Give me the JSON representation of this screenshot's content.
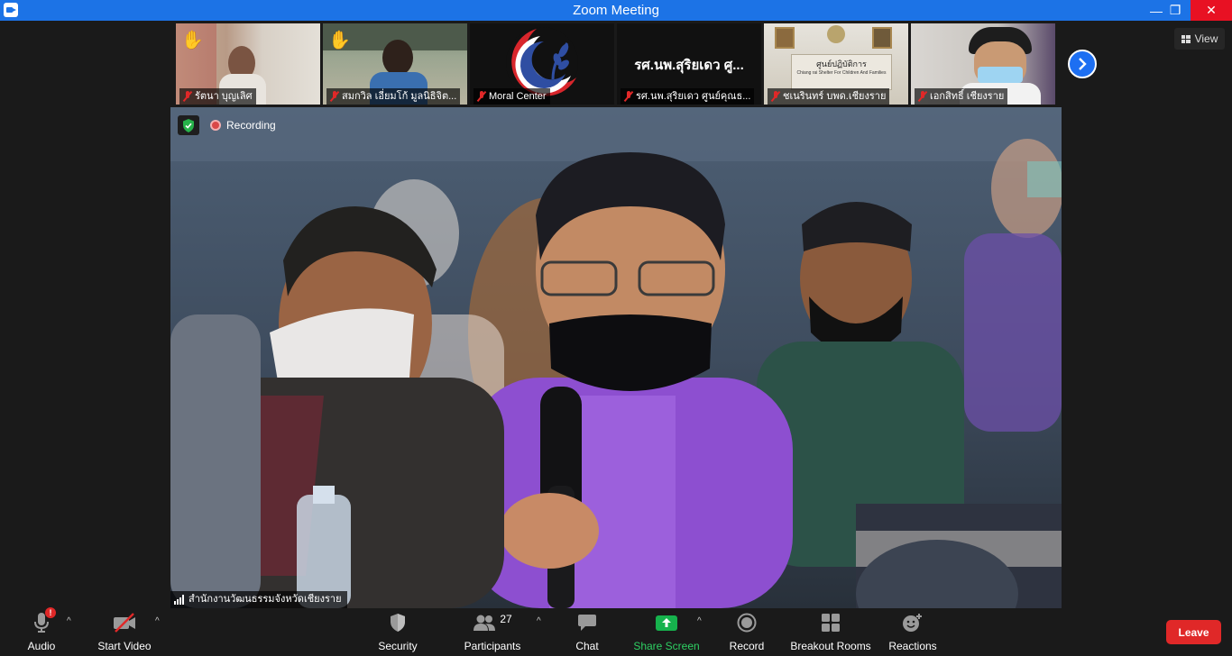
{
  "window": {
    "title": "Zoom Meeting",
    "minimize_glyph": "—",
    "restore_glyph": "❐",
    "close_glyph": "✕"
  },
  "participants": [
    {
      "name": "รัตนา บุญเลิศ",
      "hand_raised": true,
      "muted": true
    },
    {
      "name": "สมกวิล เอี่ยมโก้ มูลนิธิจิต...",
      "hand_raised": true,
      "muted": true
    },
    {
      "name": "Moral Center",
      "hand_raised": false,
      "muted": true
    },
    {
      "name": "รศ.นพ.สุริยเดว ศูนย์คุณธ...",
      "hand_raised": false,
      "muted": true,
      "tile_text": "รศ.นพ.สุริยเดว ศู..."
    },
    {
      "name": "ชเนรินทร์ บพด.เชียงราย",
      "hand_raised": false,
      "muted": true,
      "sign_title": "ศูนย์ปฏิบัติการ",
      "sign_subtitle": "Chiang rai Shelter For Children And Families"
    },
    {
      "name": "เอกสิทธิ์ เชียงราย",
      "hand_raised": false,
      "muted": true
    }
  ],
  "view_button": {
    "label": "View"
  },
  "main_video": {
    "recording_label": "Recording",
    "speaker_name": "สำนักงานวัฒนธรรมจังหวัดเชียงราย"
  },
  "toolbar": {
    "audio": {
      "label": "Audio",
      "badge": "!"
    },
    "video": {
      "label": "Start Video"
    },
    "security": {
      "label": "Security"
    },
    "participants": {
      "label": "Participants",
      "count": "27"
    },
    "chat": {
      "label": "Chat"
    },
    "share": {
      "label": "Share Screen"
    },
    "record": {
      "label": "Record"
    },
    "breakout": {
      "label": "Breakout Rooms"
    },
    "reactions": {
      "label": "Reactions"
    },
    "leave": {
      "label": "Leave"
    }
  },
  "colors": {
    "titlebar": "#1c73e6",
    "share_green": "#16b24d",
    "leave_red": "#e02828",
    "next_blue": "#1d6ff2"
  }
}
